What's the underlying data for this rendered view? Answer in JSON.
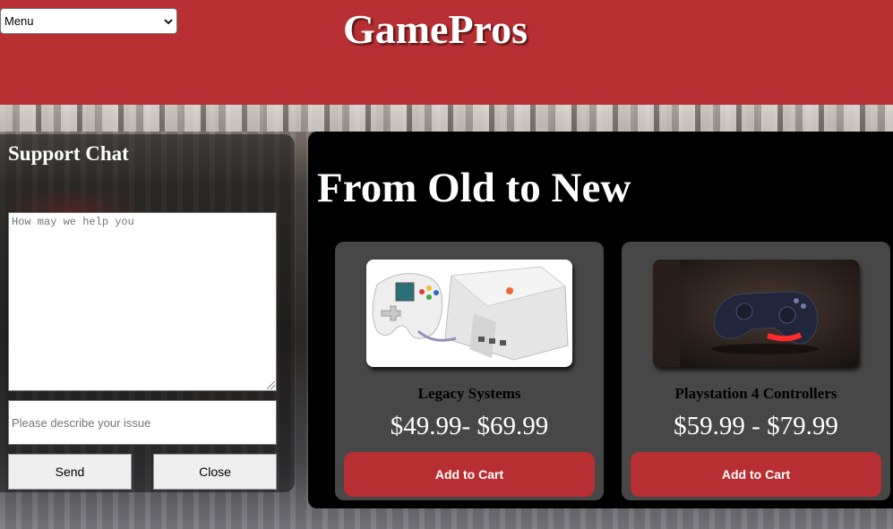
{
  "header": {
    "menu_select": "Menu",
    "site_title": "GamePros"
  },
  "chat": {
    "title": "Support Chat",
    "message_placeholder": "How may we help you",
    "issue_placeholder": "Please describe your issue",
    "send_label": "Send",
    "close_label": "Close"
  },
  "products": {
    "heading": "From Old to New",
    "items": [
      {
        "name": "Legacy Systems",
        "price": "$49.99- $69.99",
        "button": "Add to Cart",
        "image": "retro-console-image"
      },
      {
        "name": "Playstation 4 Controllers",
        "price": "$59.99 - $79.99",
        "button": "Add to Cart",
        "image": "ps4-controller-image"
      }
    ]
  },
  "colors": {
    "brand_red": "#b82f33",
    "panel_black": "#000000",
    "card_gray": "#474747"
  }
}
